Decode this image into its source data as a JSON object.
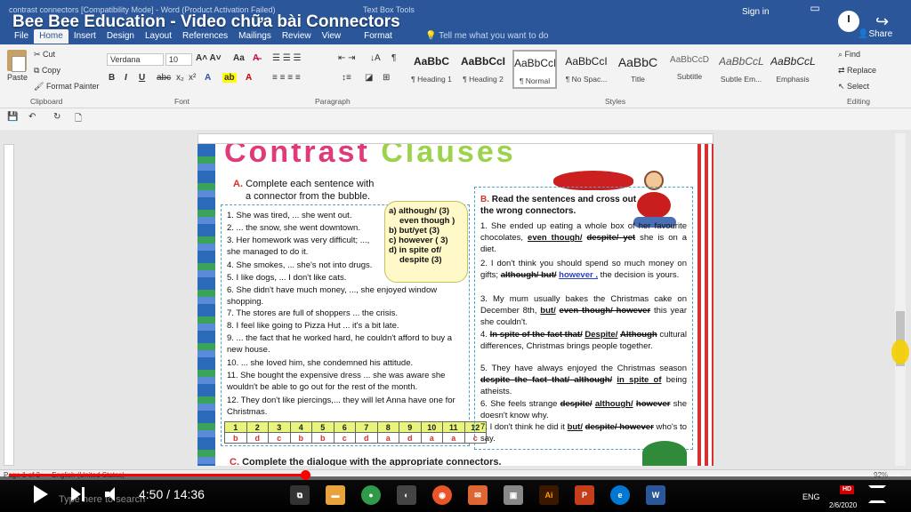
{
  "window": {
    "title": "contrast connectors [Compatibility Mode] - Word (Product Activation Failed)",
    "video_title": "Bee Bee Education - Video chữa bài Connectors",
    "context_tab": "Text Box Tools",
    "signin": "Sign in",
    "share": "Share"
  },
  "tabs": [
    "File",
    "Home",
    "Insert",
    "Design",
    "Layout",
    "References",
    "Mailings",
    "Review",
    "View",
    "Format"
  ],
  "tellme": "Tell me what you want to do",
  "ribbon": {
    "clipboard": {
      "paste": "Paste",
      "cut": "Cut",
      "copy": "Copy",
      "format_painter": "Format Painter",
      "label": "Clipboard"
    },
    "font": {
      "name": "Verdana",
      "size": "10",
      "label": "Font"
    },
    "paragraph": {
      "label": "Paragraph"
    },
    "styles": {
      "label": "Styles",
      "items": [
        {
          "preview": "AaBbC",
          "name": "¶ Heading 1"
        },
        {
          "preview": "AaBbCcI",
          "name": "¶ Heading 2"
        },
        {
          "preview": "AaBbCcI",
          "name": "¶ Normal"
        },
        {
          "preview": "AaBbCcI",
          "name": "¶ No Spac..."
        },
        {
          "preview": "AaBbC",
          "name": "Title"
        },
        {
          "preview": "AaBbCcD",
          "name": "Subtitle"
        },
        {
          "preview": "AaBbCcL",
          "name": "Subtle Em..."
        },
        {
          "preview": "AaBbCcL",
          "name": "Emphasis"
        }
      ]
    },
    "editing": {
      "find": "Find",
      "replace": "Replace",
      "select": "Select",
      "label": "Editing"
    }
  },
  "document": {
    "banner_title_a": "Contrast",
    "banner_title_b": "Clauses",
    "sectionA": {
      "letter": "A.",
      "heading_line1": "Complete each sentence with",
      "heading_line2": "a connector from the bubble.",
      "bubble": [
        "a) although/ (3)",
        "even though )",
        "b) but/yet (3)",
        "c) however ( 3)",
        "d) in spite of/",
        "despite (3)"
      ],
      "sentences": [
        "1. She was tired, ... she went out.",
        "2. ... the snow, she went downtown.",
        "3. Her homework was very difficult; ..., she managed to do it.",
        "4. She smokes, ... she's not into drugs.",
        "5. I like dogs, ... I don't like cats.",
        "6. She didn't have much money, ..., she enjoyed window shopping.",
        "7. The stores are full of shoppers ... the crisis.",
        "8. I feel like going to Pizza Hut ... it's a bit late.",
        "9. ... the fact that he worked hard, he couldn't afford to buy a new house.",
        "10. ... she loved him, she condemned his attitude.",
        "11. She bought the expensive dress ... she was aware she wouldn't be able to go out for the rest of the month.",
        "12. They don't like piercings,... they will let Anna have one for Christmas."
      ],
      "answer_numbers": [
        "1",
        "2",
        "3",
        "4",
        "5",
        "6",
        "7",
        "8",
        "9",
        "10",
        "11",
        "12"
      ],
      "answers": [
        "b",
        "d",
        "c",
        "b",
        "b",
        "c",
        "d",
        "a",
        "d",
        "a",
        "a",
        "c"
      ]
    },
    "sectionB": {
      "letter": "B.",
      "heading": "Read the sentences and cross out the wrong connectors.",
      "s1": {
        "pre": "1. She ended up eating a whole box of her favourite chocolates,",
        "keep1": "even though/",
        "cross1": "despite/ yet",
        "post": "she is on a diet."
      },
      "s2": {
        "pre": "2. I don't think you should spend so much money on gifts;",
        "cross1": "although/ but/",
        "keep1": "however ,",
        "post": "the decision is yours."
      },
      "s3": {
        "pre": "3. My mum usually bakes the Christmas cake on December 8th,",
        "keep1": "but/",
        "cross1": "even though/ however",
        "post": "this year she couldn't."
      },
      "s4": {
        "pre": "4.",
        "cross1": "In spite of the fact that/",
        "keep1": "Despite/",
        "cross2": "Although",
        "post": "cultural differences, Christmas brings people together."
      },
      "s5": {
        "pre": "5. They have always enjoyed the Christmas season",
        "cross1": "despite the fact that/ although/",
        "keep1": "in spite of",
        "post": "being atheists."
      },
      "s6": {
        "pre": "6. She feels strange",
        "cross1": "despite/",
        "keep1": "although/",
        "cross2": "however",
        "post": "she doesn't know why."
      },
      "s7": {
        "pre": "7. I don't think he did it",
        "keep1": "but/",
        "cross1": "despite/ however",
        "post": "who's to say."
      }
    },
    "sectionC": {
      "letter": "C.",
      "heading": "Complete the dialogue with the appropriate connectors."
    }
  },
  "status": {
    "page": "Page 1 of 2",
    "language": "English (United States)",
    "zoom": "92%"
  },
  "player": {
    "time": "4:50 / 14:36",
    "progress": 0.332
  },
  "taskbar": {
    "search_placeholder": "Type here to search",
    "lang": "ENG",
    "date": "2/6/2020",
    "hd": "HD"
  }
}
